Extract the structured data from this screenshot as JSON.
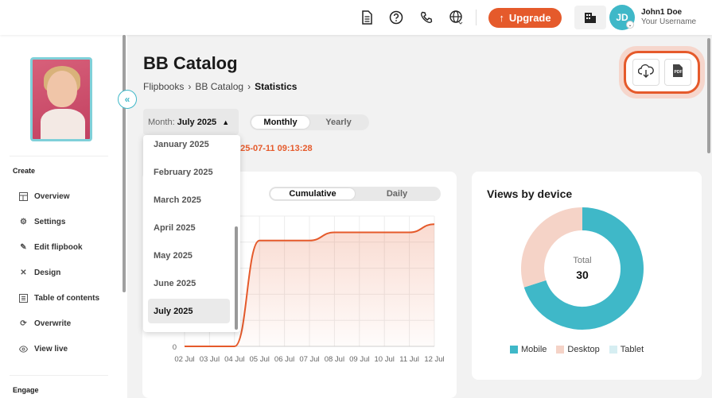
{
  "colors": {
    "accent": "#e55a2b",
    "teal": "#3fb8c8",
    "desktop": "#f5d3c7",
    "tablet": "#d6eef2"
  },
  "header": {
    "upgrade_label": "Upgrade",
    "avatar_initials": "JD",
    "user_name": "John1 Doe",
    "user_sub": "Your Username"
  },
  "sidebar": {
    "create_label": "Create",
    "engage_label": "Engage",
    "items": [
      {
        "label": "Overview",
        "icon": "layout-icon"
      },
      {
        "label": "Settings",
        "icon": "gear-icon"
      },
      {
        "label": "Edit flipbook",
        "icon": "pencil-icon"
      },
      {
        "label": "Design",
        "icon": "tools-icon"
      },
      {
        "label": "Table of contents",
        "icon": "list-icon"
      },
      {
        "label": "Overwrite",
        "icon": "refresh-icon"
      },
      {
        "label": "View live",
        "icon": "eye-icon"
      }
    ]
  },
  "page": {
    "title": "BB Catalog",
    "breadcrumb": [
      "Flipbooks",
      "BB Catalog",
      "Statistics"
    ]
  },
  "filters": {
    "month_label": "Month:",
    "month_value": "July 2025",
    "period_options": [
      "Monthly",
      "Yearly"
    ],
    "updated_text": "025-07-11 09:13:28"
  },
  "dropdown": {
    "options": [
      "January 2025",
      "February 2025",
      "March 2025",
      "April 2025",
      "May 2025",
      "June 2025",
      "July 2025"
    ],
    "selected": "July 2025"
  },
  "views_chart": {
    "toggle_options": [
      "Cumulative",
      "Daily"
    ]
  },
  "chart_data": [
    {
      "type": "area",
      "x": [
        "02 Jul",
        "03 Jul",
        "04 Jul",
        "05 Jul",
        "06 Jul",
        "07 Jul",
        "08 Jul",
        "09 Jul",
        "10 Jul",
        "11 Jul",
        "12 Jul"
      ],
      "values": [
        0,
        0,
        0,
        26,
        26,
        26,
        28,
        28,
        28,
        28,
        30
      ],
      "ytick_visible": [
        "0"
      ],
      "ylim": [
        0,
        32
      ],
      "grid": true,
      "line_color": "#e55a2b"
    },
    {
      "type": "pie",
      "title": "Views by device",
      "center_label": "Total",
      "center_value": "30",
      "categories": [
        "Mobile",
        "Desktop",
        "Tablet"
      ],
      "values": [
        21,
        9,
        0
      ],
      "colors": [
        "#3fb8c8",
        "#f5d3c7",
        "#d6eef2"
      ],
      "legend": "bottom"
    }
  ]
}
